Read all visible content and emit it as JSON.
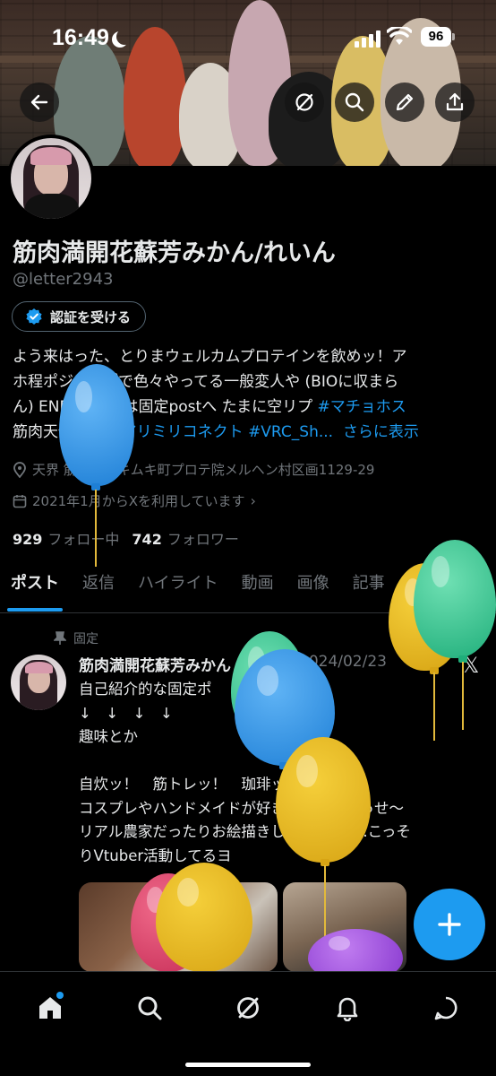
{
  "status_bar": {
    "time": "16:49",
    "battery": "96"
  },
  "header_actions": [
    "back-icon",
    "grok-icon",
    "search-icon",
    "edit-icon",
    "share-icon"
  ],
  "profile": {
    "name": "筋肉満開花蘇芳みかん/れいん",
    "handle": "@letter2943",
    "verify_button": "認証を受ける",
    "bio_lines": [
      "よう来はった、とりまウェルカムプロテインを飲めッ！ア",
      "ホ程ポジティブで色々やってる一般変人や (BIOに収まら",
      "ん) ENFJ-A 詳細は固定postへ たまに空リプ"
    ],
    "bio_tag1": "#マチョホス",
    "bio_line4_prefix": "筋肉天使先生 ",
    "bio_tag2": "#アリミリコネクト",
    "bio_tag3": "#VRC_Sh...",
    "bio_more": "さらに表示",
    "location": "天界 筋肉市ムキムキ町プロテ院メルヘン村区画1129-29",
    "joined": "2021年1月からXを利用しています",
    "following_count": "929",
    "following_label": "フォロー中",
    "followers_count": "742",
    "followers_label": "フォロワー"
  },
  "tabs": [
    "ポスト",
    "返信",
    "ハイライト",
    "動画",
    "画像",
    "記事"
  ],
  "post": {
    "pinned_label": "固定",
    "author": "筋肉満開花蘇芳みかん",
    "date": "2024/02/23",
    "body": "自己紹介的な固定ポ\n↓　↓　↓　↓\n趣味とか\n\n自炊ッ！　筋トレッ！　珈琲ッ！\nコスプレやハンドメイドが好きな一般人でっせ〜\nリアル農家だったりお絵描きしてたりも.....こっそ\nりVtuber活動してるヨ"
  },
  "bottom_nav": [
    "home-icon",
    "search-icon",
    "grok-icon",
    "notifications-icon",
    "messages-icon"
  ],
  "colors": {
    "accent": "#1d9bf0",
    "background": "#000000",
    "text": "#e7e9ea",
    "muted": "#71767b"
  }
}
